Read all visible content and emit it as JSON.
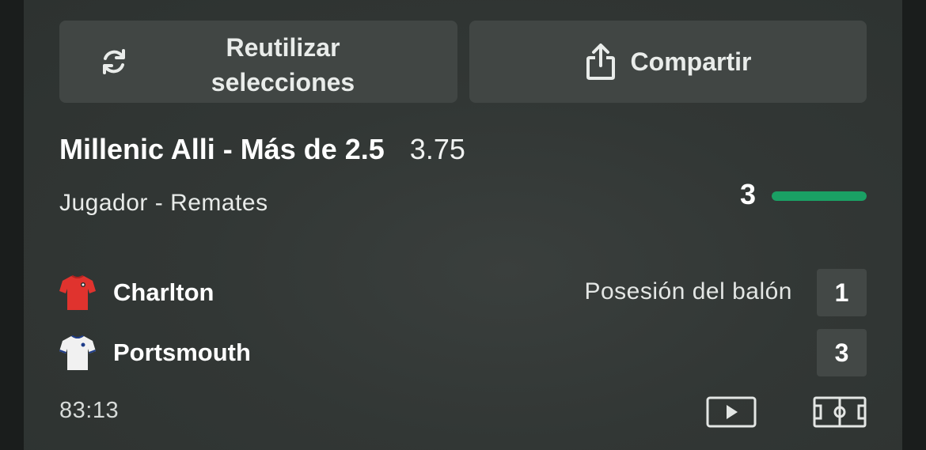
{
  "actions": {
    "reuse_label": "Reutilizar selecciones",
    "share_label": "Compartir"
  },
  "bet": {
    "title": "Millenic Alli - Más de 2.5",
    "odds": "3.75",
    "market": "Jugador - Remates",
    "progress_value": "3",
    "progress_fraction": 1.0
  },
  "match": {
    "home_team": "Charlton",
    "away_team": "Portsmouth",
    "stat_label": "Posesión del balón",
    "home_score": "1",
    "away_score": "3",
    "clock": "83:13"
  },
  "icons": {
    "reuse": "refresh-icon",
    "share": "share-icon",
    "home_kit": "red-shirt-icon",
    "away_kit": "white-shirt-icon",
    "video": "play-video-icon",
    "pitch": "pitch-icon"
  },
  "colors": {
    "progress": "#1aa064",
    "home_kit": "#e0332e",
    "away_kit": "#f1f1f1"
  }
}
